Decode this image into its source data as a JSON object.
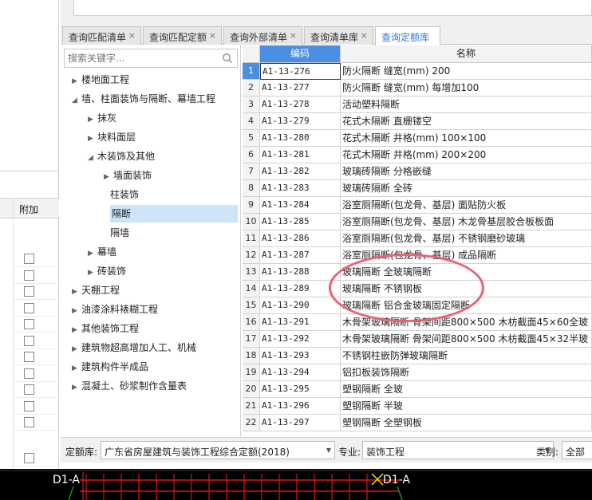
{
  "left_panel": {
    "column_header": "附加",
    "checkbox_count": 14
  },
  "tabs": [
    {
      "label": "查询匹配清单",
      "active": false
    },
    {
      "label": "查询匹配定额",
      "active": false
    },
    {
      "label": "查询外部清单",
      "active": false
    },
    {
      "label": "查询清单库",
      "active": false
    },
    {
      "label": "查询定额库",
      "active": true
    }
  ],
  "tab_close_glyph": "×",
  "search": {
    "placeholder": "搜索关键字..."
  },
  "tree": [
    {
      "label": "楼地面工程",
      "level": 0,
      "expanded": false
    },
    {
      "label": "墙、柱面装饰与隔断、幕墙工程",
      "level": 0,
      "expanded": true
    },
    {
      "label": "抹灰",
      "level": 1,
      "expanded": false
    },
    {
      "label": "块料面层",
      "level": 1,
      "expanded": false
    },
    {
      "label": "木装饰及其他",
      "level": 1,
      "expanded": true
    },
    {
      "label": "墙面装饰",
      "level": 2,
      "expanded": false
    },
    {
      "label": "柱装饰",
      "level": 2,
      "leaf": true
    },
    {
      "label": "隔断",
      "level": 2,
      "leaf": true,
      "selected": true
    },
    {
      "label": "隔墙",
      "level": 2,
      "leaf": true
    },
    {
      "label": "幕墙",
      "level": 1,
      "expanded": false
    },
    {
      "label": "砖装饰",
      "level": 1,
      "expanded": false
    },
    {
      "label": "天棚工程",
      "level": 0,
      "expanded": false
    },
    {
      "label": "油漆涂料裱糊工程",
      "level": 0,
      "expanded": false
    },
    {
      "label": "其他装饰工程",
      "level": 0,
      "expanded": false
    },
    {
      "label": "建筑物超高增加人工、机械",
      "level": 0,
      "expanded": false
    },
    {
      "label": "建筑构件半成品",
      "level": 0,
      "expanded": false
    },
    {
      "label": "混凝土、砂浆制作含量表",
      "level": 0,
      "expanded": false
    }
  ],
  "grid": {
    "headers": {
      "code": "编码",
      "name": "名称"
    },
    "rows": [
      {
        "num": "1",
        "code": "A1-13-276",
        "name": "防火隔断 缝宽(mm) 200"
      },
      {
        "num": "2",
        "code": "A1-13-277",
        "name": "防火隔断 缝宽(mm) 每增加100"
      },
      {
        "num": "3",
        "code": "A1-13-278",
        "name": "活动塑料隔断"
      },
      {
        "num": "4",
        "code": "A1-13-279",
        "name": "花式木隔断 直栅镂空"
      },
      {
        "num": "5",
        "code": "A1-13-280",
        "name": "花式木隔断 井格(mm) 100×100"
      },
      {
        "num": "6",
        "code": "A1-13-281",
        "name": "花式木隔断 井格(mm) 200×200"
      },
      {
        "num": "7",
        "code": "A1-13-282",
        "name": "玻璃砖隔断 分格嵌缝"
      },
      {
        "num": "8",
        "code": "A1-13-283",
        "name": "玻璃砖隔断 全砖"
      },
      {
        "num": "9",
        "code": "A1-13-284",
        "name": "浴室厕隔断(包龙骨、基层) 面贴防火板"
      },
      {
        "num": "10",
        "code": "A1-13-285",
        "name": "浴室厕隔断(包龙骨、基层) 木龙骨基层胶合板板面"
      },
      {
        "num": "11",
        "code": "A1-13-286",
        "name": "浴室厕隔断(包龙骨、基层) 不锈钢磨砂玻璃"
      },
      {
        "num": "12",
        "code": "A1-13-287",
        "name": "浴室厕隔断(包龙骨、基层) 成品隔断"
      },
      {
        "num": "13",
        "code": "A1-13-288",
        "name": "玻璃隔断 全玻璃隔断"
      },
      {
        "num": "14",
        "code": "A1-13-289",
        "name": "玻璃隔断 不锈钢板"
      },
      {
        "num": "15",
        "code": "A1-13-290",
        "name": "玻璃隔断 铝合金玻璃固定隔断"
      },
      {
        "num": "16",
        "code": "A1-13-291",
        "name": "木骨架玻璃隔断 骨架间距800×500 木枋截面45×60全玻"
      },
      {
        "num": "17",
        "code": "A1-13-292",
        "name": "木骨架玻璃隔断 骨架间距800×500 木枋截面45×32半玻"
      },
      {
        "num": "18",
        "code": "A1-13-293",
        "name": "不锈钢柱嵌防弹玻璃隔断"
      },
      {
        "num": "19",
        "code": "A1-13-294",
        "name": "铝扣板装饰隔断"
      },
      {
        "num": "20",
        "code": "A1-13-295",
        "name": "塑钢隔断 全玻"
      },
      {
        "num": "21",
        "code": "A1-13-296",
        "name": "塑钢隔断 半玻"
      },
      {
        "num": "22",
        "code": "A1-13-297",
        "name": "塑钢隔断 全塑钢板"
      }
    ]
  },
  "filter": {
    "library_label": "定额库:",
    "library_value": "广东省房屋建筑与装饰工程综合定额(2018)",
    "major_label": "专业:",
    "major_value": "装饰工程",
    "category_label": "类别:",
    "category_value": "全部"
  },
  "cad": {
    "label_left": "D1-A",
    "label_right": "D1-A"
  },
  "colors": {
    "accent": "#2f7bd8",
    "selected_row": "#4a90e2",
    "annotation": "#e8637a"
  }
}
